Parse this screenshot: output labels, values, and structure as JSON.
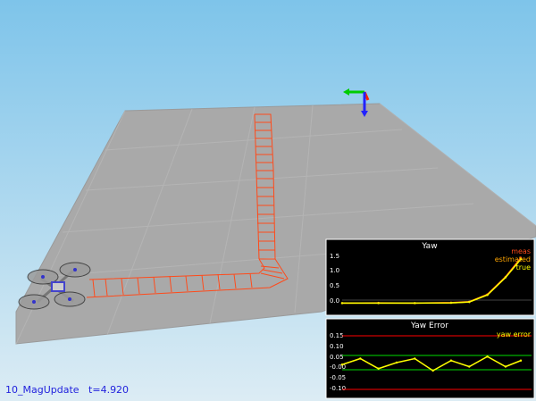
{
  "window": {
    "status_text": "10_MagUpdate   t=4.920",
    "sky_top": "#7ec4ea",
    "sky_bottom": "#dcecf4",
    "floor_color": "#a9a9a9",
    "trajectory_color": "#ff4a1a"
  },
  "plots": {
    "yaw": {
      "title": "Yaw",
      "legend": [
        {
          "label": "meas",
          "color": "#ff4a1a"
        },
        {
          "label": "estimated",
          "color": "#ffa500"
        },
        {
          "label": "true",
          "color": "#ffff00"
        }
      ],
      "tick_labels": [
        "1.5",
        "1.0",
        "0.5",
        "0.0"
      ]
    },
    "yaw_error": {
      "title": "Yaw Error",
      "legend": [
        {
          "label": "yaw error",
          "color": "#ffff00"
        }
      ],
      "tick_labels": [
        "0.15",
        "0.10",
        "0.05",
        "-0.00",
        "-0.05",
        "-0.10"
      ],
      "sigma_color": "#ff0000"
    }
  },
  "chart_data": [
    {
      "type": "line",
      "title": "Yaw",
      "ylim": [
        -0.2,
        1.75
      ],
      "x": [
        0.0,
        1.0,
        2.0,
        3.0,
        3.5,
        4.0,
        4.5,
        4.92
      ],
      "series": [
        {
          "name": "meas",
          "values": [
            0.0,
            0.01,
            0.0,
            0.02,
            0.05,
            0.3,
            0.9,
            1.55
          ]
        },
        {
          "name": "estimated",
          "values": [
            0.0,
            0.0,
            0.0,
            0.01,
            0.04,
            0.28,
            0.88,
            1.5
          ]
        },
        {
          "name": "true",
          "values": [
            0.0,
            0.0,
            0.0,
            0.01,
            0.04,
            0.28,
            0.88,
            1.5
          ]
        }
      ]
    },
    {
      "type": "line",
      "title": "Yaw Error",
      "ylim": [
        -0.15,
        0.17
      ],
      "x": [
        0.0,
        0.5,
        1.0,
        1.5,
        2.0,
        2.5,
        3.0,
        3.5,
        4.0,
        4.5,
        4.92
      ],
      "series": [
        {
          "name": "yaw error",
          "values": [
            0.0,
            0.03,
            -0.02,
            0.01,
            0.03,
            -0.03,
            0.02,
            -0.01,
            0.04,
            -0.01,
            0.02
          ]
        }
      ]
    }
  ]
}
